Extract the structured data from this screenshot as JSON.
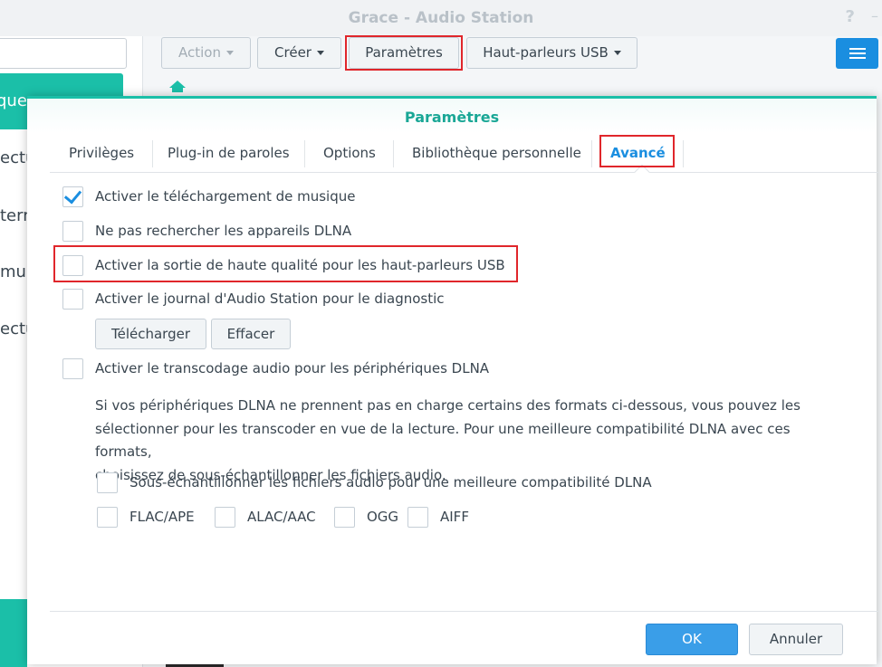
{
  "window": {
    "title": "Grace - Audio Station",
    "help_icon": "?"
  },
  "sidebar": {
    "items": [
      {
        "label": "que"
      },
      {
        "label": "ectu"
      },
      {
        "label": "tern"
      },
      {
        "label": "mult"
      },
      {
        "label": "ectu"
      }
    ]
  },
  "toolbar": {
    "action_label": "Action",
    "create_label": "Créer",
    "settings_label": "Paramètres",
    "speakers_label": "Haut-parleurs USB"
  },
  "dialog": {
    "title": "Paramètres",
    "tabs": [
      {
        "label": "Privilèges"
      },
      {
        "label": "Plug-in de paroles"
      },
      {
        "label": "Options"
      },
      {
        "label": "Bibliothèque personnelle"
      },
      {
        "label": "Avancé"
      }
    ],
    "options": {
      "download_music": {
        "label": "Activer le téléchargement de musique",
        "checked": true
      },
      "no_dlna_search": {
        "label": "Ne pas rechercher les appareils DLNA",
        "checked": false
      },
      "usb_hq_output": {
        "label": "Activer la sortie de haute qualité pour les haut-parleurs USB",
        "checked": false
      },
      "debug_log": {
        "label": "Activer le journal d'Audio Station pour le diagnostic",
        "checked": false
      },
      "dlna_transcode": {
        "label": "Activer le transcodage audio pour les périphériques DLNA",
        "checked": false
      },
      "downsample": {
        "label": "Sous-échantillonner les fichiers audio pour une meilleure compatibilité DLNA",
        "checked": false
      }
    },
    "log_buttons": {
      "download_label": "Télécharger",
      "clear_label": "Effacer"
    },
    "transcode_help_lines": [
      "Si vos périphériques DLNA ne prennent pas en charge certains des formats ci-dessous, vous pouvez les",
      "sélectionner pour les transcoder en vue de la lecture. Pour une meilleure compatibilité DLNA avec ces formats,",
      "choisissez de sous-échantillonner les fichiers audio."
    ],
    "formats": [
      {
        "label": "FLAC/APE",
        "checked": false
      },
      {
        "label": "ALAC/AAC",
        "checked": false
      },
      {
        "label": "OGG",
        "checked": false
      },
      {
        "label": "AIFF",
        "checked": false
      }
    ],
    "ok_label": "OK",
    "cancel_label": "Annuler"
  },
  "colors": {
    "accent": "#1bbfa8",
    "primary": "#1a8ee0",
    "highlight": "#e0262b"
  }
}
